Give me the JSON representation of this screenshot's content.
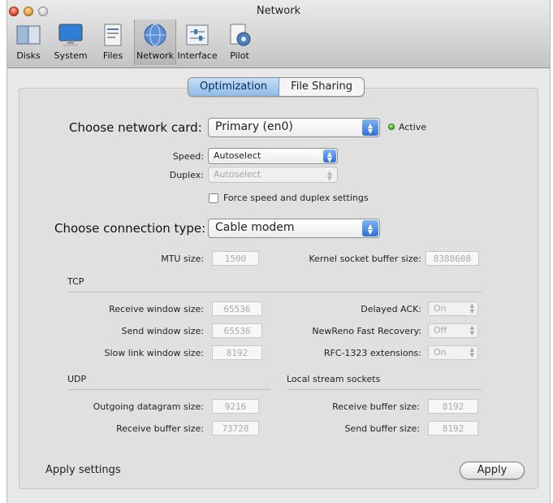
{
  "window": {
    "title": "Network"
  },
  "toolbar": {
    "items": [
      {
        "label": "Disks",
        "icon": "disks-icon"
      },
      {
        "label": "System",
        "icon": "monitor-icon"
      },
      {
        "label": "Files",
        "icon": "files-icon"
      },
      {
        "label": "Network",
        "icon": "network-globe-icon",
        "selected": true
      },
      {
        "label": "Interface",
        "icon": "interface-sliders-icon"
      },
      {
        "label": "Pilot",
        "icon": "pilot-icon"
      }
    ]
  },
  "tabs": {
    "active": "Optimization",
    "other": "File Sharing"
  },
  "network_card": {
    "label": "Choose network card:",
    "value": "Primary (en0)",
    "status": "Active",
    "status_color": "#3aa816"
  },
  "speed": {
    "label": "Speed:",
    "value": "Autoselect"
  },
  "duplex": {
    "label": "Duplex:",
    "value": "Autoselect"
  },
  "force_checkbox": {
    "label": "Force speed and duplex settings",
    "checked": false
  },
  "connection": {
    "label": "Choose connection type:",
    "value": "Cable modem"
  },
  "mtu": {
    "label": "MTU size:",
    "value": "1500"
  },
  "kernel_buffer": {
    "label": "Kernel socket buffer size:",
    "value": "8388608"
  },
  "tcp": {
    "header": "TCP",
    "receive_window": {
      "label": "Receive window size:",
      "value": "65536"
    },
    "send_window": {
      "label": "Send window size:",
      "value": "65536"
    },
    "slow_link": {
      "label": "Slow link window size:",
      "value": "8192"
    },
    "delayed_ack": {
      "label": "Delayed ACK:",
      "value": "On"
    },
    "newreno": {
      "label": "NewReno Fast Recovery:",
      "value": "Off"
    },
    "rfc1323": {
      "label": "RFC-1323 extensions:",
      "value": "On"
    }
  },
  "udp": {
    "header": "UDP",
    "outgoing": {
      "label": "Outgoing datagram size:",
      "value": "9216"
    },
    "receive": {
      "label": "Receive buffer size:",
      "value": "73728"
    }
  },
  "local_stream": {
    "header": "Local stream sockets",
    "receive": {
      "label": "Receive buffer size:",
      "value": "8192"
    },
    "send": {
      "label": "Send buffer size:",
      "value": "8192"
    }
  },
  "footer": {
    "label": "Apply settings",
    "button": "Apply"
  }
}
